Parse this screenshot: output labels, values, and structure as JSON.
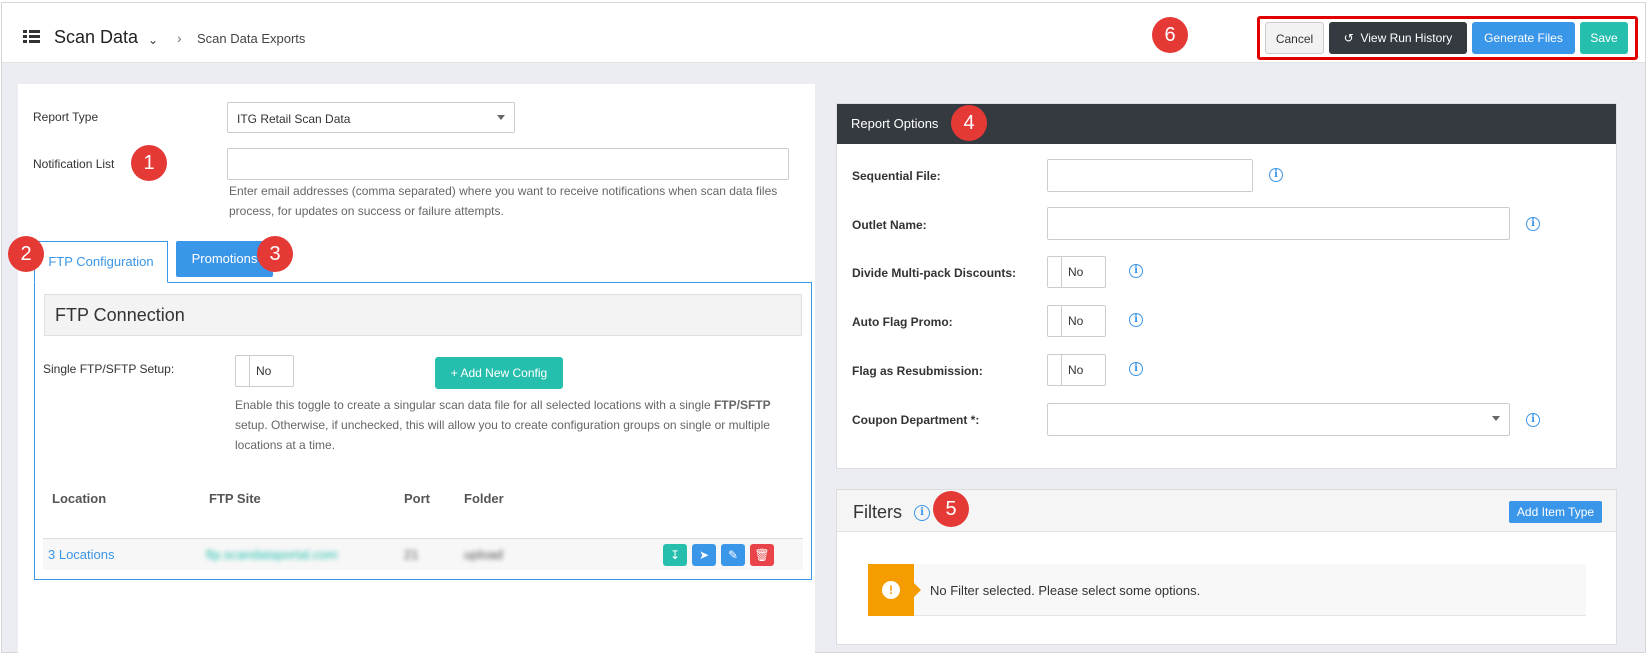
{
  "header": {
    "title": "Scan Data",
    "breadcrumb": "Scan Data Exports",
    "buttons": {
      "cancel": "Cancel",
      "view_run_history": "View Run History",
      "generate_files": "Generate Files",
      "save": "Save"
    }
  },
  "badges": [
    "1",
    "2",
    "3",
    "4",
    "5",
    "6"
  ],
  "form": {
    "report_type_label": "Report Type",
    "report_type_value": "ITG Retail Scan Data",
    "notification_label": "Notification List",
    "notification_value": "",
    "notification_help": "Enter email addresses (comma separated) where you want to receive notifications when scan data files process, for updates on success or failure attempts."
  },
  "tabs": {
    "ftp": "FTP Configuration",
    "promotions": "Promotions"
  },
  "ftp": {
    "section_title": "FTP Connection",
    "single_setup_label": "Single FTP/SFTP Setup:",
    "single_setup_value": "No",
    "add_config": "+ Add New Config",
    "help_1": "Enable this toggle to create a singular scan data file for all selected locations with a single",
    "help_bold": "FTP/SFTP",
    "help_2": " setup. Otherwise, if unchecked, this will allow you to create configuration groups on single or multiple locations at a time.",
    "columns": [
      "Location",
      "FTP Site",
      "Port",
      "Folder"
    ],
    "rows": [
      {
        "location": "3 Locations",
        "ftp_site": "ftp.scandataportal.com",
        "port": "21",
        "folder": "upload"
      }
    ]
  },
  "report_options": {
    "title": "Report Options",
    "sequential_file": {
      "label": "Sequential File:",
      "value": ""
    },
    "outlet_name": {
      "label": "Outlet Name:",
      "value": ""
    },
    "divide_multipack": {
      "label": "Divide Multi-pack Discounts:",
      "value": "No"
    },
    "auto_flag_promo": {
      "label": "Auto Flag Promo:",
      "value": "No"
    },
    "flag_resubmission": {
      "label": "Flag as Resubmission:",
      "value": "No"
    },
    "coupon_department": {
      "label": "Coupon Department *:",
      "value": ""
    }
  },
  "filters": {
    "title": "Filters",
    "add_item_type": "Add Item Type",
    "empty_message": "No Filter selected. Please select some options."
  },
  "colors": {
    "primary": "#3a96e8",
    "teal": "#26bfad",
    "dark": "#343a40",
    "badge": "#e53935",
    "highlight_border": "#e00000",
    "warning": "#f59c00"
  }
}
